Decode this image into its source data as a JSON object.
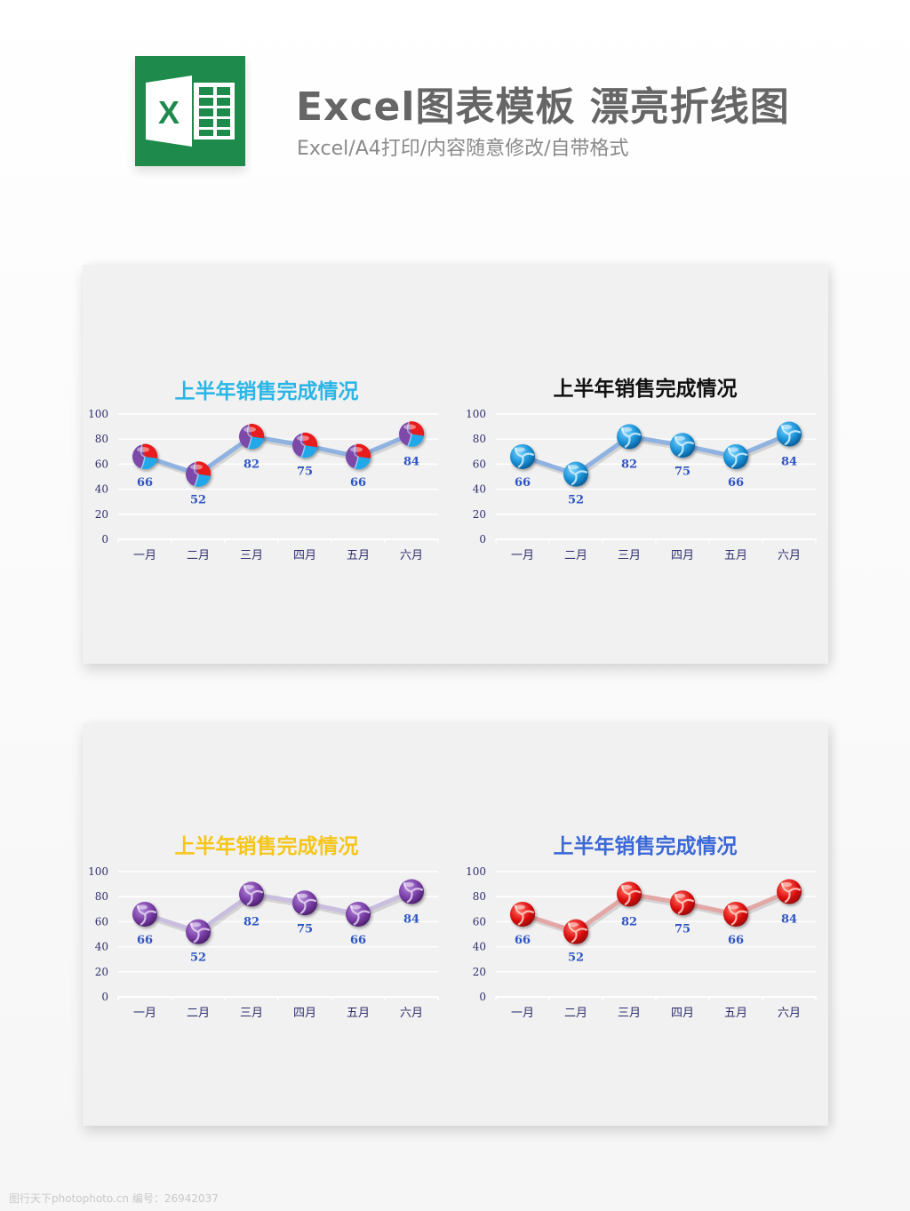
{
  "header": {
    "title": "Excel图表模板 漂亮折线图",
    "subtitle": "Excel/A4打印/内容随意修改/自带格式",
    "logo_letter": "X",
    "logo_color": "#1e8a4c"
  },
  "watermark": "图行天下photophoto.cn  编号：26942037",
  "chart_data": [
    {
      "type": "line",
      "title": "上半年销售完成情况",
      "title_color": "#29b6e6",
      "marker_style": "tricolor",
      "line_color": "#8fb2e0",
      "categories": [
        "一月",
        "二月",
        "三月",
        "四月",
        "五月",
        "六月"
      ],
      "values": [
        66,
        52,
        82,
        75,
        66,
        84
      ],
      "data_labels": [
        "66",
        "52",
        "82",
        "75",
        "66",
        "84"
      ],
      "yticks": [
        "0",
        "20",
        "40",
        "60",
        "80",
        "100"
      ],
      "ylim": [
        0,
        100
      ],
      "grid": true,
      "xlabel": "",
      "ylabel": ""
    },
    {
      "type": "line",
      "title": "上半年销售完成情况",
      "title_color": "#111111",
      "marker_style": "blue",
      "line_color": "#8fb2e0",
      "categories": [
        "一月",
        "二月",
        "三月",
        "四月",
        "五月",
        "六月"
      ],
      "values": [
        66,
        52,
        82,
        75,
        66,
        84
      ],
      "data_labels": [
        "66",
        "52",
        "82",
        "75",
        "66",
        "84"
      ],
      "yticks": [
        "0",
        "20",
        "40",
        "60",
        "80",
        "100"
      ],
      "ylim": [
        0,
        100
      ],
      "grid": true,
      "xlabel": "",
      "ylabel": ""
    },
    {
      "type": "line",
      "title": "上半年销售完成情况",
      "title_color": "#f5c518",
      "marker_style": "purple",
      "line_color": "#c9bede",
      "categories": [
        "一月",
        "二月",
        "三月",
        "四月",
        "五月",
        "六月"
      ],
      "values": [
        66,
        52,
        82,
        75,
        66,
        84
      ],
      "data_labels": [
        "66",
        "52",
        "82",
        "75",
        "66",
        "84"
      ],
      "yticks": [
        "0",
        "20",
        "40",
        "60",
        "80",
        "100"
      ],
      "ylim": [
        0,
        100
      ],
      "grid": true,
      "xlabel": "",
      "ylabel": ""
    },
    {
      "type": "line",
      "title": "上半年销售完成情况",
      "title_color": "#3a68d6",
      "marker_style": "red",
      "line_color": "#e3a7a5",
      "categories": [
        "一月",
        "二月",
        "三月",
        "四月",
        "五月",
        "六月"
      ],
      "values": [
        66,
        52,
        82,
        75,
        66,
        84
      ],
      "data_labels": [
        "66",
        "52",
        "82",
        "75",
        "66",
        "84"
      ],
      "yticks": [
        "0",
        "20",
        "40",
        "60",
        "80",
        "100"
      ],
      "ylim": [
        0,
        100
      ],
      "grid": true,
      "xlabel": "",
      "ylabel": ""
    }
  ],
  "colors": {
    "axis_text": "#2e2e6e",
    "data_label": "#2f55c4",
    "gridline": "#ffffff"
  }
}
